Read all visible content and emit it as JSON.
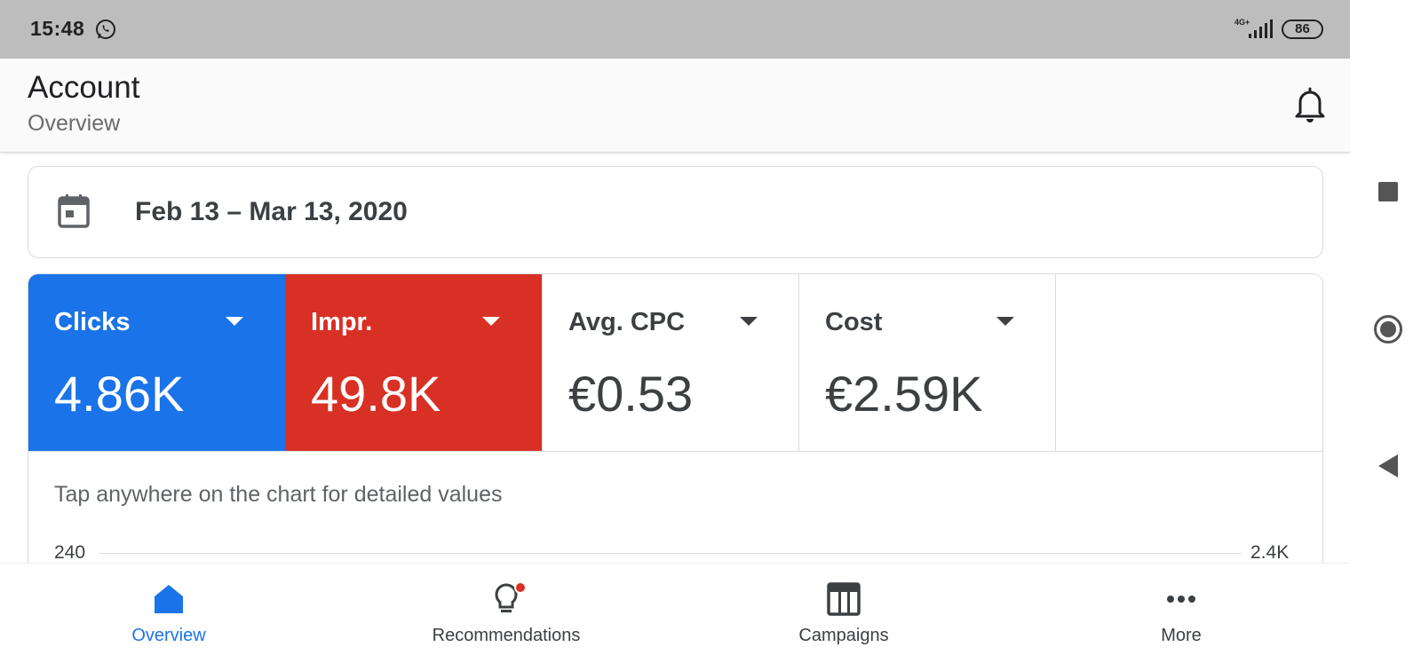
{
  "status_bar": {
    "time": "15:48",
    "network": "4G+",
    "battery": "86",
    "icons": [
      "whatsapp-icon",
      "signal-icon",
      "battery-icon"
    ]
  },
  "header": {
    "title": "Account",
    "subtitle": "Overview",
    "icon": "bell-icon"
  },
  "date_range": {
    "label": "Feb 13 – Mar 13, 2020",
    "icon": "calendar-icon"
  },
  "metrics": [
    {
      "label": "Clicks",
      "value": "4.86K",
      "color": "#1a73e8"
    },
    {
      "label": "Impr.",
      "value": "49.8K",
      "color": "#d93025"
    },
    {
      "label": "Avg. CPC",
      "value": "€0.53",
      "color": "#ffffff"
    },
    {
      "label": "Cost",
      "value": "€2.59K",
      "color": "#ffffff"
    }
  ],
  "chart": {
    "hint": "Tap anywhere on the chart for detailed values",
    "left_axis_top": "240",
    "right_axis_top": "2.4K"
  },
  "bottom_nav": [
    {
      "label": "Overview",
      "icon": "home-icon",
      "active": true
    },
    {
      "label": "Recommendations",
      "icon": "lightbulb-icon",
      "badge": true
    },
    {
      "label": "Campaigns",
      "icon": "campaigns-icon"
    },
    {
      "label": "More",
      "icon": "more-dots-icon"
    }
  ],
  "colors": {
    "accent": "#1a73e8",
    "red": "#d93025",
    "status_bar": "#bdbdbd"
  }
}
